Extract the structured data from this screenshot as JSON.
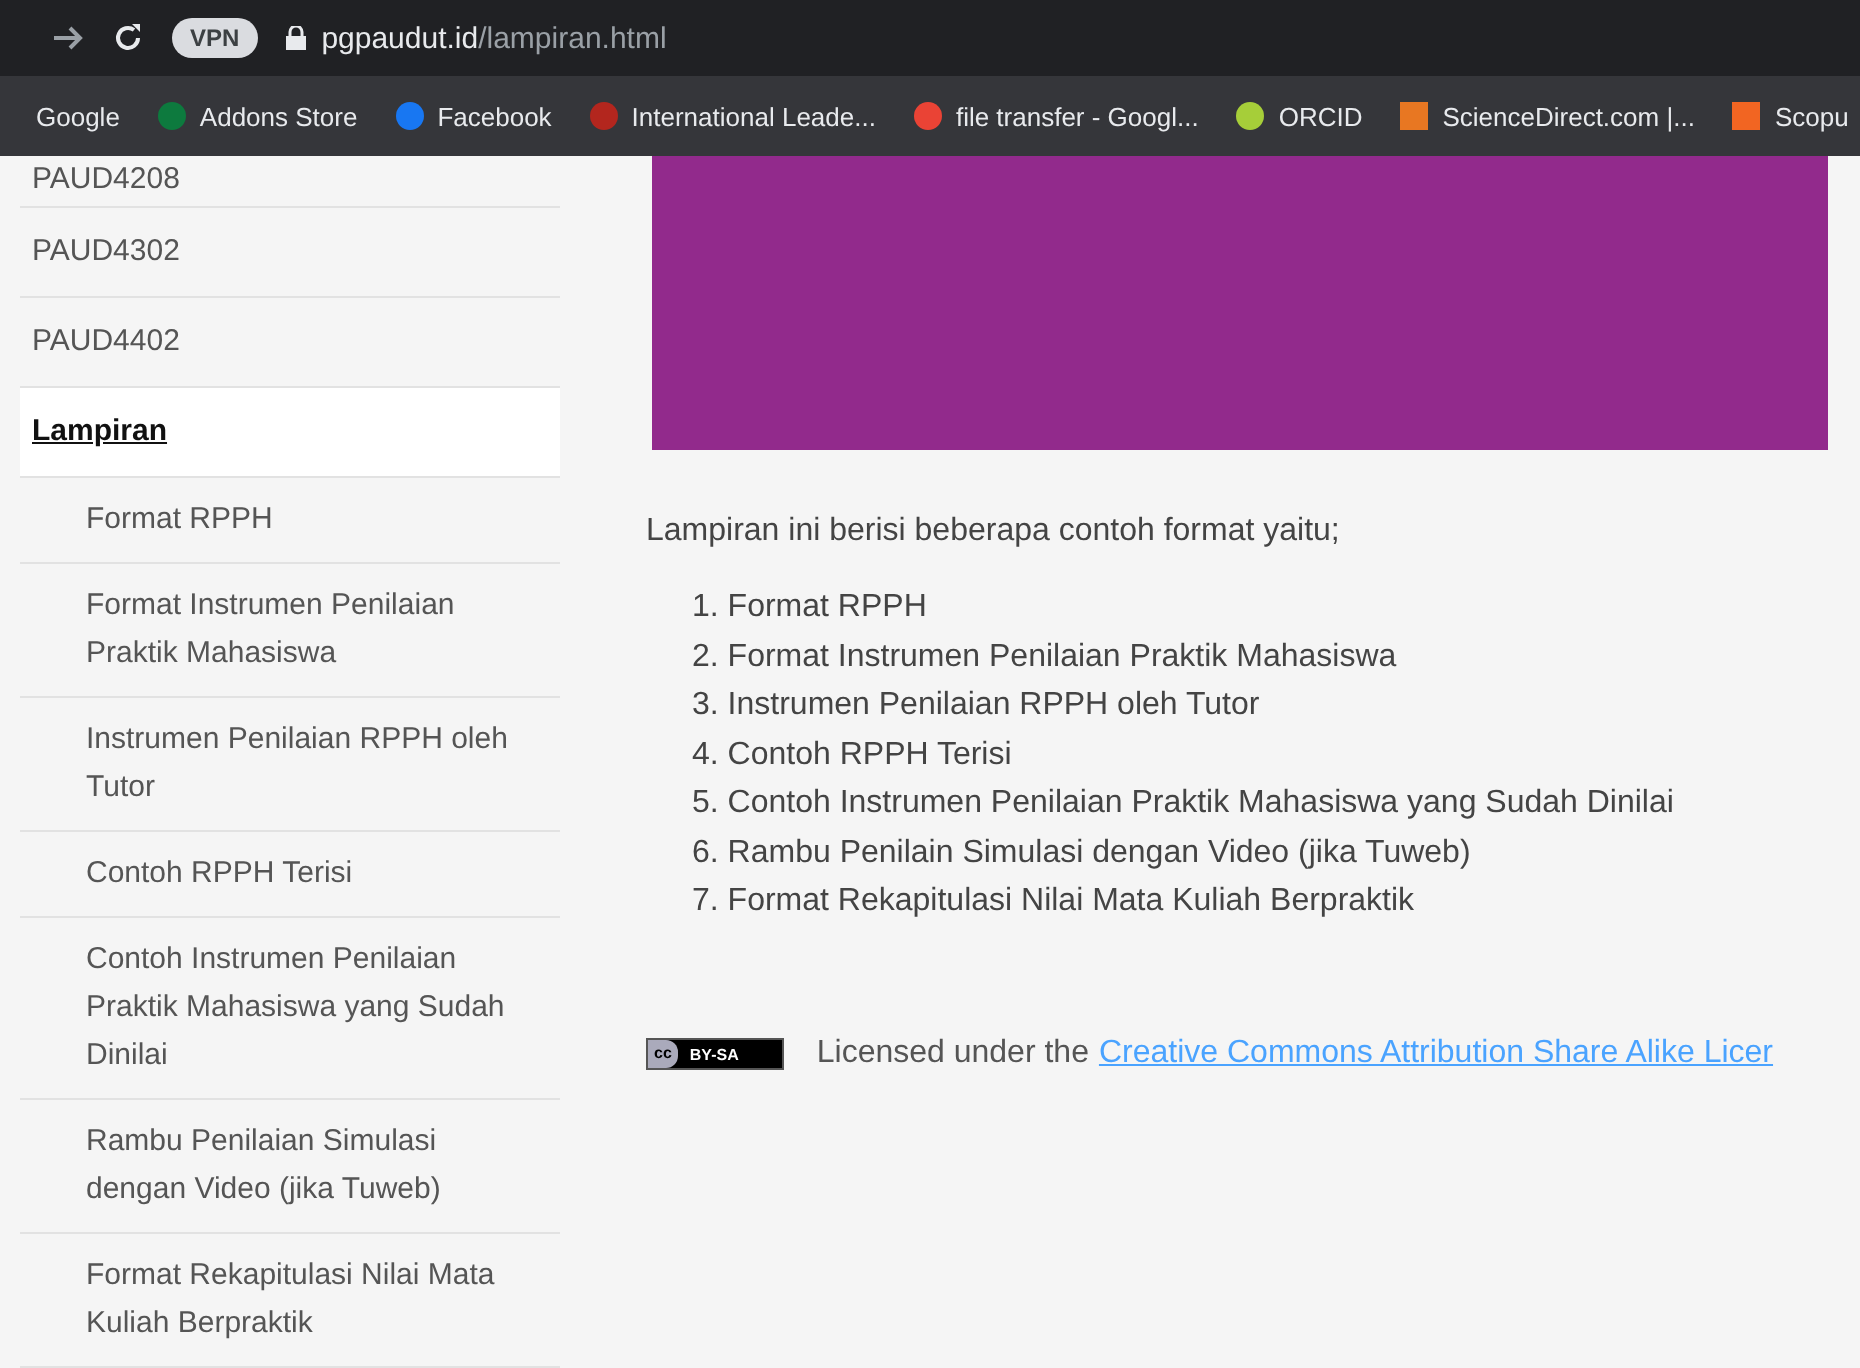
{
  "browser": {
    "url_host": "pgpaudut.id",
    "url_path": "/lampiran.html",
    "vpn_badge": "VPN",
    "bookmarks": [
      "Google",
      "Addons Store",
      "Facebook",
      "International Leade...",
      "file transfer - Googl...",
      "ORCID",
      "ScienceDirect.com |...",
      "Scopu"
    ]
  },
  "sidebar": {
    "items": [
      {
        "label": "PAUD4208",
        "selected": false
      },
      {
        "label": "PAUD4302",
        "selected": false
      },
      {
        "label": "PAUD4402",
        "selected": false
      },
      {
        "label": "Lampiran",
        "selected": true,
        "children": [
          {
            "label": "Format RPPH"
          },
          {
            "label": "Format Instrumen Penilaian Praktik Mahasiswa"
          },
          {
            "label": "Instrumen Penilaian RPPH oleh Tutor"
          },
          {
            "label": "Contoh RPPH Terisi"
          },
          {
            "label": "Contoh Instrumen Penilaian Praktik Mahasiswa yang Sudah Dinilai"
          },
          {
            "label": "Rambu Penilaian Simulasi dengan Video (jika Tuweb)"
          },
          {
            "label": "Format Rekapitulasi Nilai Mata Kuliah Berpraktik"
          }
        ]
      }
    ]
  },
  "content": {
    "intro": "Lampiran ini berisi beberapa contoh format yaitu;",
    "list": [
      {
        "number": "1.",
        "text": "Format RPPH"
      },
      {
        "number": "2.",
        "text": "Format Instrumen Penilaian Praktik Mahasiswa"
      },
      {
        "number": "3.",
        "text": "Instrumen Penilaian RPPH oleh Tutor"
      },
      {
        "number": "4.",
        "text": "Contoh RPPH Terisi"
      },
      {
        "number": "5.",
        "text": "Contoh Instrumen Penilaian Praktik Mahasiswa yang Sudah Dinilai"
      },
      {
        "number": "6.",
        "text": "Rambu Penilain Simulasi dengan Video (jika Tuweb)"
      },
      {
        "number": "7.",
        "text": "Format Rekapitulasi Nilai Mata Kuliah Berpraktik"
      }
    ],
    "license": {
      "badge_left": "cc",
      "badge_right": "BY-SA",
      "text": "Licensed under the",
      "link": "Creative Commons Attribution Share Alike Licer"
    }
  }
}
